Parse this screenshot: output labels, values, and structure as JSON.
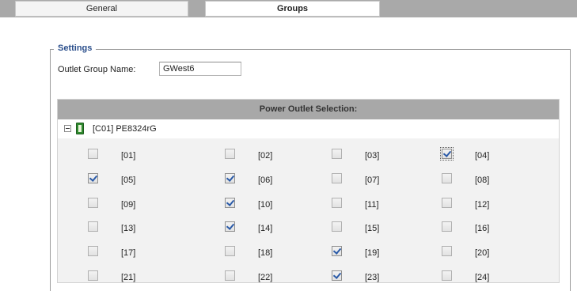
{
  "tabs": [
    {
      "label": "General",
      "active": false
    },
    {
      "label": "Groups",
      "active": true
    }
  ],
  "settings": {
    "legend": "Settings",
    "outlet_group_name_label": "Outlet Group Name:",
    "outlet_group_name_value": "GWest6"
  },
  "power_outlet_selection": {
    "header": "Power Outlet Selection:",
    "pdu": {
      "label": "[C01] PE8324rG",
      "icon": "pdu-device-icon",
      "expanded": true
    },
    "outlets": [
      {
        "label": "[01]",
        "checked": false
      },
      {
        "label": "[02]",
        "checked": false
      },
      {
        "label": "[03]",
        "checked": false
      },
      {
        "label": "[04]",
        "checked": true,
        "focused": true
      },
      {
        "label": "[05]",
        "checked": true
      },
      {
        "label": "[06]",
        "checked": true
      },
      {
        "label": "[07]",
        "checked": false
      },
      {
        "label": "[08]",
        "checked": false
      },
      {
        "label": "[09]",
        "checked": false
      },
      {
        "label": "[10]",
        "checked": true
      },
      {
        "label": "[11]",
        "checked": false
      },
      {
        "label": "[12]",
        "checked": false
      },
      {
        "label": "[13]",
        "checked": false
      },
      {
        "label": "[14]",
        "checked": true
      },
      {
        "label": "[15]",
        "checked": false
      },
      {
        "label": "[16]",
        "checked": false
      },
      {
        "label": "[17]",
        "checked": false
      },
      {
        "label": "[18]",
        "checked": false
      },
      {
        "label": "[19]",
        "checked": true
      },
      {
        "label": "[20]",
        "checked": false
      },
      {
        "label": "[21]",
        "checked": false
      },
      {
        "label": "[22]",
        "checked": false
      },
      {
        "label": "[23]",
        "checked": true
      },
      {
        "label": "[24]",
        "checked": false
      }
    ]
  },
  "colors": {
    "accent_text": "#2b4f8c",
    "header_bg": "#a8a8a8",
    "checkmark": "#2a5aa8"
  }
}
